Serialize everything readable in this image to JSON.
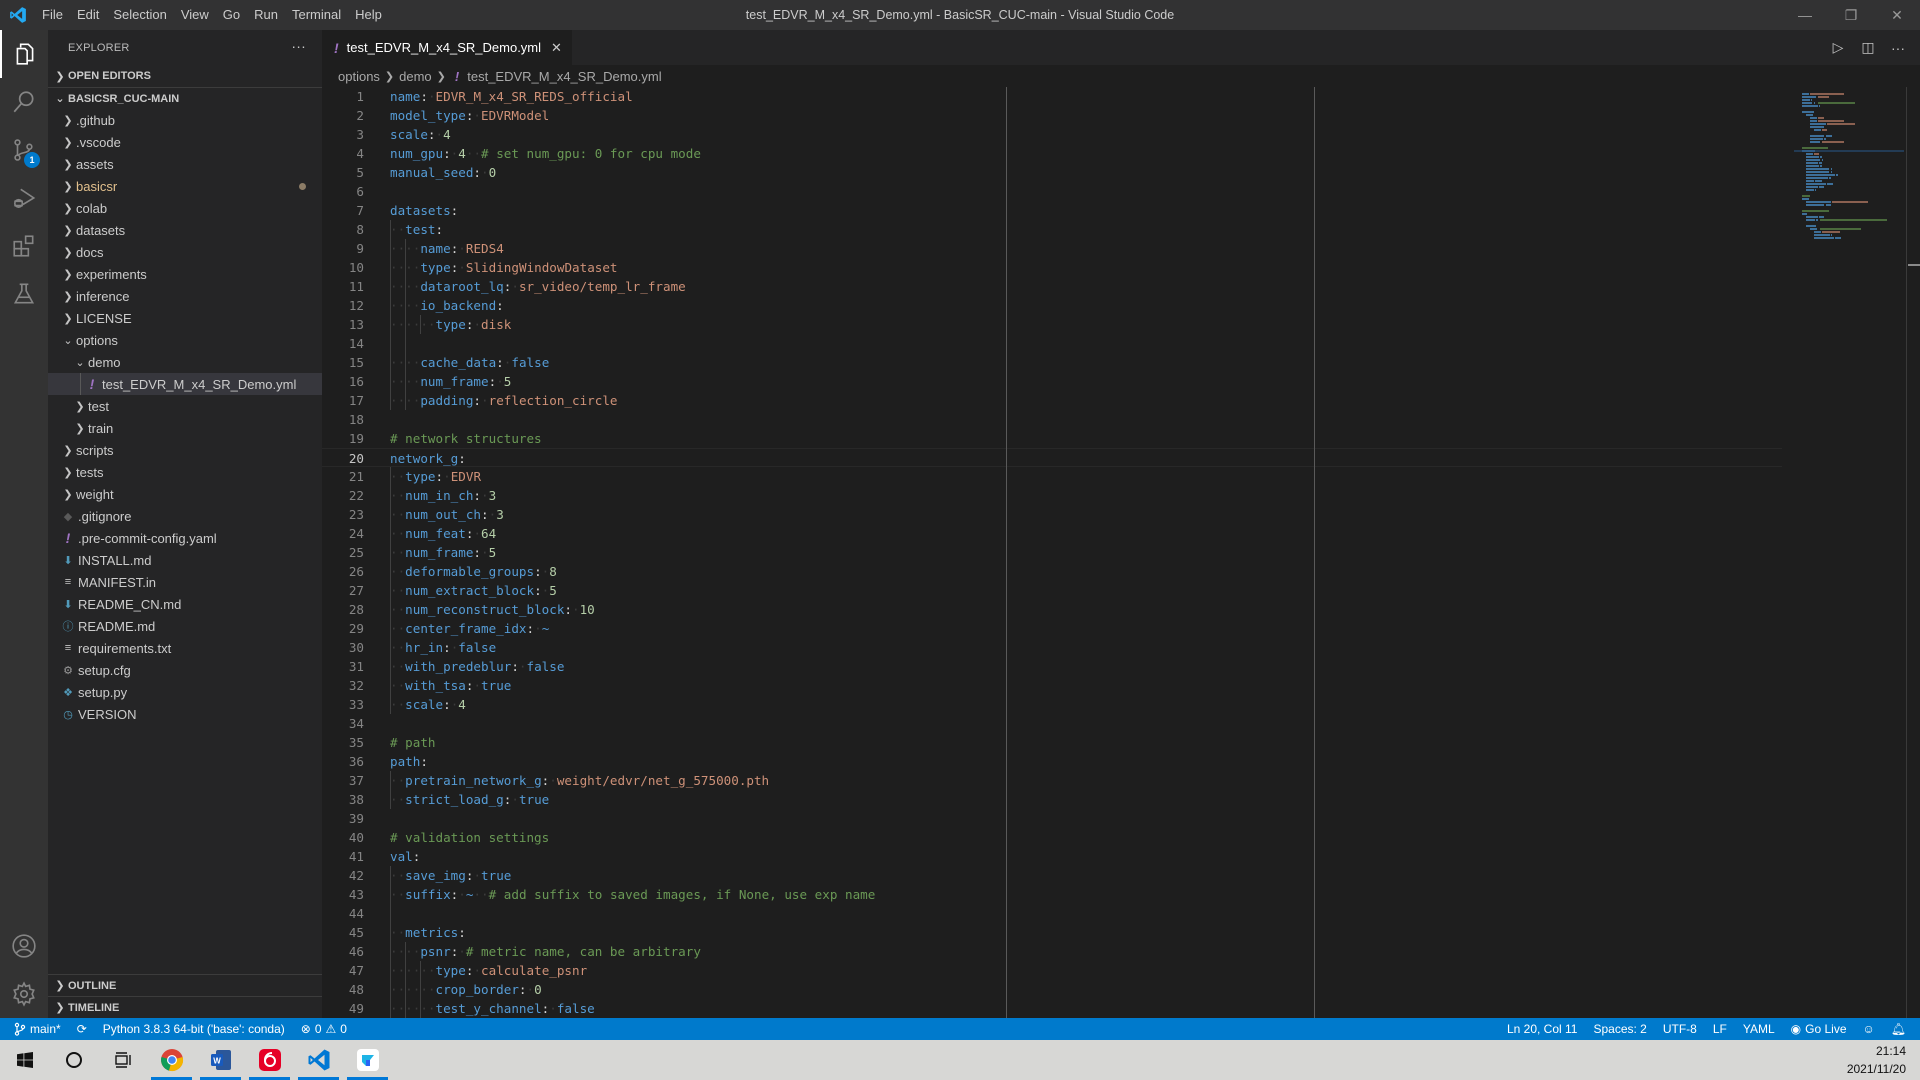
{
  "window": {
    "title": "test_EDVR_M_x4_SR_Demo.yml - BasicSR_CUC-main - Visual Studio Code",
    "menu": [
      "File",
      "Edit",
      "Selection",
      "View",
      "Go",
      "Run",
      "Terminal",
      "Help"
    ],
    "controls": {
      "minimize": "—",
      "restore": "❐",
      "close": "✕"
    }
  },
  "activity_bar": {
    "items": [
      {
        "name": "explorer",
        "icon": "files-icon",
        "active": true
      },
      {
        "name": "search",
        "icon": "search-icon"
      },
      {
        "name": "source-control",
        "icon": "source-control-icon",
        "badge": "1"
      },
      {
        "name": "run-debug",
        "icon": "run-debug-icon"
      },
      {
        "name": "extensions",
        "icon": "extensions-icon"
      },
      {
        "name": "testing",
        "icon": "flask-icon"
      }
    ],
    "bottom": [
      {
        "name": "accounts",
        "icon": "account-icon"
      },
      {
        "name": "manage",
        "icon": "gear-icon"
      }
    ]
  },
  "sidebar": {
    "title": "EXPLORER",
    "more": "···",
    "open_editors": "OPEN EDITORS",
    "root": "BASICSR_CUC-MAIN",
    "tree": [
      {
        "label": ".github",
        "type": "folder",
        "depth": 1
      },
      {
        "label": ".vscode",
        "type": "folder",
        "depth": 1
      },
      {
        "label": "assets",
        "type": "folder",
        "depth": 1
      },
      {
        "label": "basicsr",
        "type": "folder",
        "depth": 1,
        "modified": true
      },
      {
        "label": "colab",
        "type": "folder",
        "depth": 1
      },
      {
        "label": "datasets",
        "type": "folder",
        "depth": 1
      },
      {
        "label": "docs",
        "type": "folder",
        "depth": 1
      },
      {
        "label": "experiments",
        "type": "folder",
        "depth": 1
      },
      {
        "label": "inference",
        "type": "folder",
        "depth": 1
      },
      {
        "label": "LICENSE",
        "type": "folder",
        "depth": 1
      },
      {
        "label": "options",
        "type": "folder-open",
        "depth": 1
      },
      {
        "label": "demo",
        "type": "folder-open",
        "depth": 2
      },
      {
        "label": "test_EDVR_M_x4_SR_Demo.yml",
        "type": "yaml",
        "depth": 3,
        "selected": true
      },
      {
        "label": "test",
        "type": "folder",
        "depth": 2
      },
      {
        "label": "train",
        "type": "folder",
        "depth": 2
      },
      {
        "label": "scripts",
        "type": "folder",
        "depth": 1
      },
      {
        "label": "tests",
        "type": "folder",
        "depth": 1
      },
      {
        "label": "weight",
        "type": "folder",
        "depth": 1
      },
      {
        "label": ".gitignore",
        "type": "git",
        "depth": 1
      },
      {
        "label": ".pre-commit-config.yaml",
        "type": "yaml",
        "depth": 1
      },
      {
        "label": "INSTALL.md",
        "type": "markdown",
        "depth": 1
      },
      {
        "label": "MANIFEST.in",
        "type": "text",
        "depth": 1
      },
      {
        "label": "README_CN.md",
        "type": "markdown",
        "depth": 1
      },
      {
        "label": "README.md",
        "type": "info",
        "depth": 1
      },
      {
        "label": "requirements.txt",
        "type": "text",
        "depth": 1
      },
      {
        "label": "setup.cfg",
        "type": "gear",
        "depth": 1
      },
      {
        "label": "setup.py",
        "type": "python",
        "depth": 1
      },
      {
        "label": "VERSION",
        "type": "clock",
        "depth": 1
      }
    ],
    "outline": "OUTLINE",
    "timeline": "TIMELINE"
  },
  "editor": {
    "tab": {
      "label": "test_EDVR_M_x4_SR_Demo.yml",
      "icon": "!",
      "close": "✕"
    },
    "actions": {
      "run": "▷",
      "split": "◫",
      "more": "···"
    },
    "breadcrumb": [
      "options",
      "demo",
      "test_EDVR_M_x4_SR_Demo.yml"
    ],
    "current_line": 20,
    "lines": [
      {
        "indent": 0,
        "key": "name",
        "value": "EDVR_M_x4_SR_REDS_official",
        "vtype": "s"
      },
      {
        "indent": 0,
        "key": "model_type",
        "value": "EDVRModel",
        "vtype": "s"
      },
      {
        "indent": 0,
        "key": "scale",
        "value": "4",
        "vtype": "n"
      },
      {
        "indent": 0,
        "key": "num_gpu",
        "value": "4",
        "vtype": "n",
        "comment": "# set num_gpu: 0 for cpu mode"
      },
      {
        "indent": 0,
        "key": "manual_seed",
        "value": "0",
        "vtype": "n"
      },
      {},
      {
        "indent": 0,
        "key": "datasets",
        "value": ""
      },
      {
        "indent": 1,
        "key": "test",
        "value": ""
      },
      {
        "indent": 2,
        "key": "name",
        "value": "REDS4",
        "vtype": "s"
      },
      {
        "indent": 2,
        "key": "type",
        "value": "SlidingWindowDataset",
        "vtype": "s"
      },
      {
        "indent": 2,
        "key": "dataroot_lq",
        "value": "sr_video/temp_lr_frame",
        "vtype": "s"
      },
      {
        "indent": 2,
        "key": "io_backend",
        "value": ""
      },
      {
        "indent": 3,
        "key": "type",
        "value": "disk",
        "vtype": "s"
      },
      {},
      {
        "indent": 2,
        "key": "cache_data",
        "value": "false",
        "vtype": "k"
      },
      {
        "indent": 2,
        "key": "num_frame",
        "value": "5",
        "vtype": "n"
      },
      {
        "indent": 2,
        "key": "padding",
        "value": "reflection_circle",
        "vtype": "s"
      },
      {},
      {
        "indent": 0,
        "comment": "# network structures"
      },
      {
        "indent": 0,
        "key": "network_g",
        "value": ""
      },
      {
        "indent": 1,
        "key": "type",
        "value": "EDVR",
        "vtype": "s"
      },
      {
        "indent": 1,
        "key": "num_in_ch",
        "value": "3",
        "vtype": "n"
      },
      {
        "indent": 1,
        "key": "num_out_ch",
        "value": "3",
        "vtype": "n"
      },
      {
        "indent": 1,
        "key": "num_feat",
        "value": "64",
        "vtype": "n"
      },
      {
        "indent": 1,
        "key": "num_frame",
        "value": "5",
        "vtype": "n"
      },
      {
        "indent": 1,
        "key": "deformable_groups",
        "value": "8",
        "vtype": "n"
      },
      {
        "indent": 1,
        "key": "num_extract_block",
        "value": "5",
        "vtype": "n"
      },
      {
        "indent": 1,
        "key": "num_reconstruct_block",
        "value": "10",
        "vtype": "n"
      },
      {
        "indent": 1,
        "key": "center_frame_idx",
        "value": "~",
        "vtype": "k"
      },
      {
        "indent": 1,
        "key": "hr_in",
        "value": "false",
        "vtype": "k"
      },
      {
        "indent": 1,
        "key": "with_predeblur",
        "value": "false",
        "vtype": "k"
      },
      {
        "indent": 1,
        "key": "with_tsa",
        "value": "true",
        "vtype": "k"
      },
      {
        "indent": 1,
        "key": "scale",
        "value": "4",
        "vtype": "n"
      },
      {},
      {
        "indent": 0,
        "comment": "# path"
      },
      {
        "indent": 0,
        "key": "path",
        "value": ""
      },
      {
        "indent": 1,
        "key": "pretrain_network_g",
        "value": "weight/edvr/net_g_575000.pth",
        "vtype": "s"
      },
      {
        "indent": 1,
        "key": "strict_load_g",
        "value": "true",
        "vtype": "k"
      },
      {},
      {
        "indent": 0,
        "comment": "# validation settings"
      },
      {
        "indent": 0,
        "key": "val",
        "value": ""
      },
      {
        "indent": 1,
        "key": "save_img",
        "value": "true",
        "vtype": "k"
      },
      {
        "indent": 1,
        "key": "suffix",
        "value": "~",
        "vtype": "k",
        "comment": "# add suffix to saved images, if None, use exp name"
      },
      {},
      {
        "indent": 1,
        "key": "metrics",
        "value": ""
      },
      {
        "indent": 2,
        "key": "psnr",
        "value": "",
        "comment": "# metric name, can be arbitrary"
      },
      {
        "indent": 3,
        "key": "type",
        "value": "calculate_psnr",
        "vtype": "s"
      },
      {
        "indent": 3,
        "key": "crop_border",
        "value": "0",
        "vtype": "n"
      },
      {
        "indent": 3,
        "key": "test_y_channel",
        "value": "false",
        "vtype": "k"
      }
    ]
  },
  "statusbar": {
    "branch": "main*",
    "sync_icon": "⟳",
    "interpreter": "Python 3.8.3 64-bit ('base': conda)",
    "errors": "0",
    "warnings": "0",
    "position": "Ln 20, Col 11",
    "indent": "Spaces: 2",
    "encoding": "UTF-8",
    "eol": "LF",
    "language": "YAML",
    "go_live": "Go Live"
  },
  "taskbar": {
    "apps": [
      "Google Chrome",
      "Microsoft Word",
      "NetEase Cloud Music",
      "Visual Studio Code",
      "Feishu"
    ],
    "time": "21:14",
    "date": "2021/11/20"
  },
  "colors": {
    "accent": "#007acc",
    "key": "#569cd6",
    "string": "#ce9178",
    "number": "#b5cea8",
    "comment": "#6a9955",
    "yaml_icon": "#a074c4",
    "modified": "#e2c08d"
  }
}
